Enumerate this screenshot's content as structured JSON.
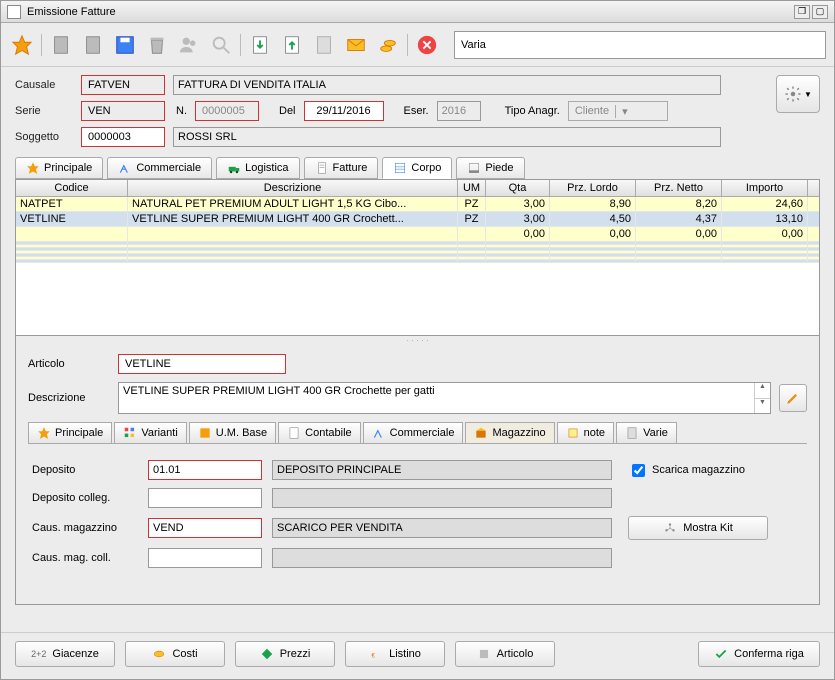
{
  "window": {
    "title": "Emissione Fatture"
  },
  "toolbar": {
    "varia": "Varia"
  },
  "header": {
    "causale_label": "Causale",
    "causale": "FATVEN",
    "causale_desc": "FATTURA DI VENDITA ITALIA",
    "serie_label": "Serie",
    "serie": "VEN",
    "n_label": "N.",
    "numero": "0000005",
    "del_label": "Del",
    "data": "29/11/2016",
    "eser_label": "Eser.",
    "eser": "2016",
    "tipoanagr_label": "Tipo Anagr.",
    "tipoanagr": "Cliente",
    "soggetto_label": "Soggetto",
    "soggetto": "0000003",
    "soggetto_desc": "ROSSI SRL"
  },
  "tabs": {
    "principale": "Principale",
    "commerciale": "Commerciale",
    "logistica": "Logistica",
    "fatture": "Fatture",
    "corpo": "Corpo",
    "piede": "Piede"
  },
  "grid": {
    "headers": {
      "codice": "Codice",
      "descrizione": "Descrizione",
      "um": "UM",
      "qta": "Qta",
      "lordo": "Prz. Lordo",
      "netto": "Prz. Netto",
      "importo": "Importo"
    },
    "rows": [
      {
        "codice": "NATPET",
        "descrizione": "NATURAL PET PREMIUM ADULT LIGHT 1,5 KG Cibo...",
        "um": "PZ",
        "qta": "3,00",
        "lordo": "8,90",
        "netto": "8,20",
        "importo": "24,60",
        "cls": "row-yellow"
      },
      {
        "codice": "VETLINE",
        "descrizione": "VETLINE SUPER PREMIUM LIGHT 400 GR Crochett...",
        "um": "PZ",
        "qta": "3,00",
        "lordo": "4,50",
        "netto": "4,37",
        "importo": "13,10",
        "cls": "row-blue"
      },
      {
        "codice": "",
        "descrizione": "",
        "um": "",
        "qta": "0,00",
        "lordo": "0,00",
        "netto": "0,00",
        "importo": "0,00",
        "cls": "row-yellow"
      }
    ]
  },
  "detail": {
    "articolo_label": "Articolo",
    "articolo": "VETLINE",
    "descrizione_label": "Descrizione",
    "descrizione": "VETLINE SUPER PREMIUM LIGHT 400 GR Crochette per gatti"
  },
  "subtabs": {
    "principale": "Principale",
    "varianti": "Varianti",
    "umbase": "U.M. Base",
    "contabile": "Contabile",
    "commerciale": "Commerciale",
    "magazzino": "Magazzino",
    "note": "note",
    "varie": "Varie"
  },
  "magazzino": {
    "deposito_label": "Deposito",
    "deposito": "01.01",
    "deposito_desc": "DEPOSITO PRINCIPALE",
    "deposito_colleg_label": "Deposito colleg.",
    "deposito_colleg": "",
    "caus_mag_label": "Caus. magazzino",
    "caus_mag": "VEND",
    "caus_mag_desc": "SCARICO PER VENDITA",
    "caus_mag_coll_label": "Caus. mag. coll.",
    "caus_mag_coll": "",
    "scarica_label": "Scarica magazzino",
    "scarica": true,
    "mostra_kit": "Mostra Kit"
  },
  "footer": {
    "giacenze": "Giacenze",
    "costi": "Costi",
    "prezzi": "Prezzi",
    "listino": "Listino",
    "articolo": "Articolo",
    "conferma": "Conferma riga"
  }
}
